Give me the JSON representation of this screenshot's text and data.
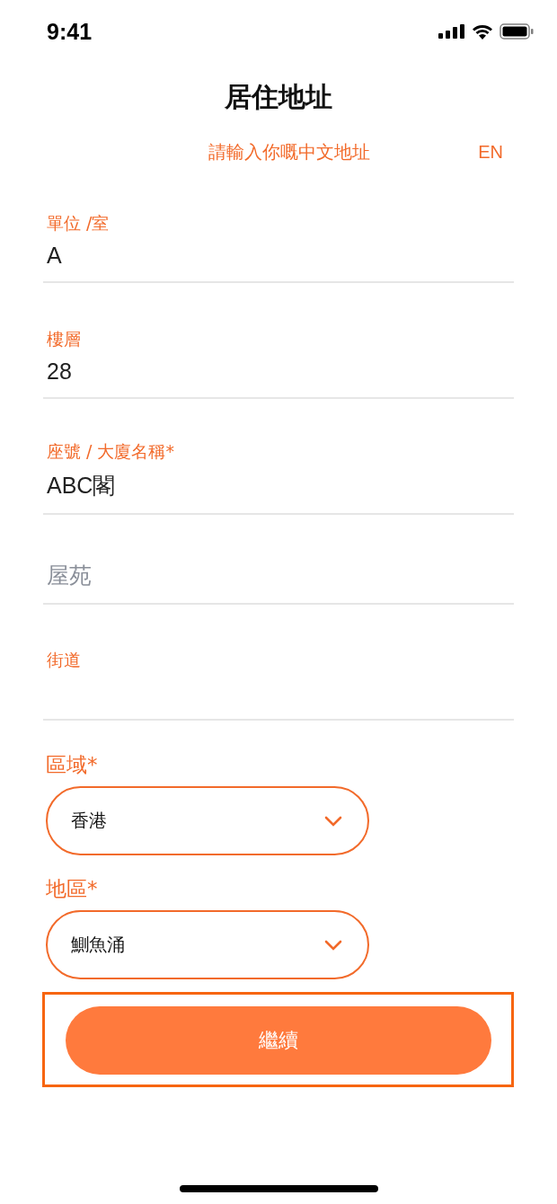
{
  "status_bar": {
    "time": "9:41"
  },
  "title": "居住地址",
  "subtitle": "請輸入你嘅中文地址",
  "language_toggle": "EN",
  "fields": [
    {
      "label": "單位 /室",
      "value": "A"
    },
    {
      "label": "樓層",
      "value": "28"
    },
    {
      "label": "座號 / 大廈名稱*",
      "value": "ABC閣"
    },
    {
      "placeholder": "屋苑"
    },
    {
      "label": "街道"
    }
  ],
  "dropdowns": [
    {
      "label": "區域*",
      "value": "香港"
    },
    {
      "label": "地區*",
      "value": "鰂魚涌"
    }
  ],
  "continue_button": {
    "label": "繼續",
    "highlighted": true
  }
}
